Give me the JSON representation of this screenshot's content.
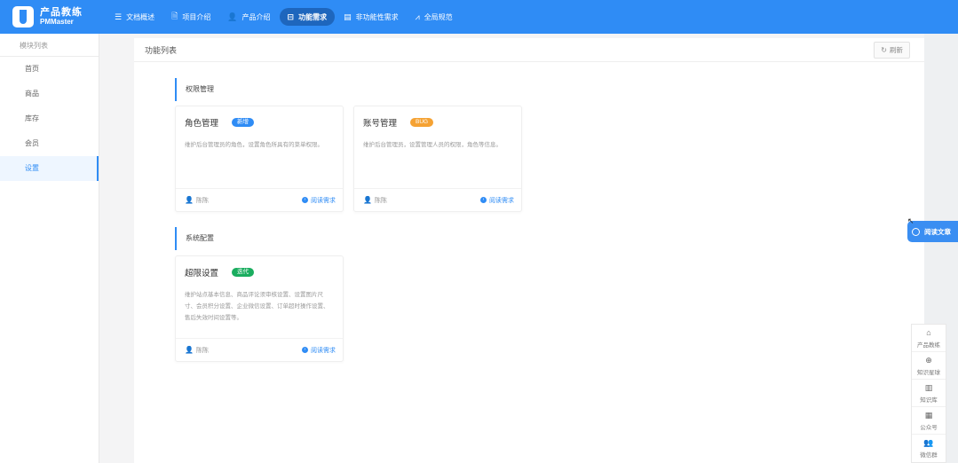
{
  "brand": {
    "name_cn": "产品教练",
    "name_en": "PMMaster"
  },
  "nav": [
    {
      "icon": "list-icon",
      "glyph": "☰",
      "label": "文档概述"
    },
    {
      "icon": "file-icon",
      "glyph": "🗎",
      "label": "项目介绍"
    },
    {
      "icon": "user-icon",
      "glyph": "👤",
      "label": "产品介绍"
    },
    {
      "icon": "package-icon",
      "glyph": "⊟",
      "label": "功能需求"
    },
    {
      "icon": "document-icon",
      "glyph": "▤",
      "label": "非功能性需求"
    },
    {
      "icon": "chart-icon",
      "glyph": "⩘",
      "label": "全局规范"
    }
  ],
  "nav_active_index": 3,
  "sidebar": {
    "header": "模块列表",
    "items": [
      "首页",
      "商品",
      "库存",
      "会员",
      "设置"
    ],
    "active_index": 4
  },
  "main": {
    "title": "功能列表",
    "refresh_label": "刷新",
    "sections": [
      {
        "title": "权限管理",
        "cards": [
          {
            "title": "角色管理",
            "badge": "新增",
            "badge_color": "#2f8cf5",
            "desc": "维护后台管理员的角色，设置角色所具有的菜单权限。",
            "author": "陈陈",
            "link": "阅读需求"
          },
          {
            "title": "账号管理",
            "badge": "BUG",
            "badge_color": "#f5a233",
            "desc": "维护后台管理员，设置管理人员的权限，角色等信息。",
            "author": "陈陈",
            "link": "阅读需求"
          }
        ]
      },
      {
        "title": "系统配置",
        "cards": [
          {
            "title": "超限设置",
            "badge": "迭代",
            "badge_color": "#1aad5f",
            "desc": "维护站点基本信息、商品评论须审核设置、设置图片尺寸、会员积分设置、企业微信设置、订单超时操作设置、售后失效时间设置等。",
            "author": "陈陈",
            "link": "阅读需求"
          }
        ]
      }
    ]
  },
  "read_article_label": "阅读文章",
  "float_menu": [
    {
      "icon": "home-icon",
      "glyph": "⌂",
      "label": "产品教练"
    },
    {
      "icon": "globe-icon",
      "glyph": "⊕",
      "label": "知识星球"
    },
    {
      "icon": "book-icon",
      "glyph": "▥",
      "label": "知识库"
    },
    {
      "icon": "qrcode-icon",
      "glyph": "▦",
      "label": "公众号"
    },
    {
      "icon": "group-icon",
      "glyph": "👥",
      "label": "微信群"
    }
  ]
}
